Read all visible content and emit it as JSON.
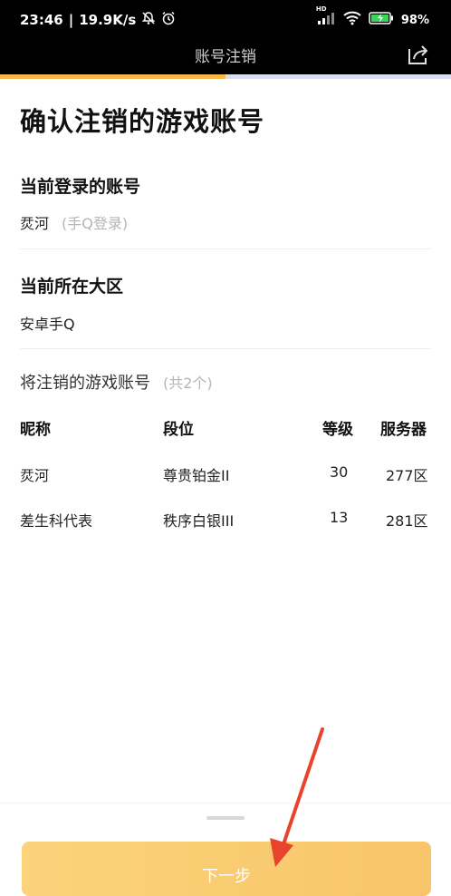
{
  "status_bar": {
    "time": "23:46",
    "speed": "19.9K/s",
    "battery": "98%",
    "hd_label": "HD"
  },
  "header": {
    "title": "账号注销",
    "progress_fraction": 0.5
  },
  "page": {
    "heading": "确认注销的游戏账号",
    "current_account_label": "当前登录的账号",
    "current_account_value": "烎河",
    "current_account_hint": "(手Q登录)",
    "region_label": "当前所在大区",
    "region_value": "安卓手Q",
    "to_cancel_label": "将注销的游戏账号",
    "to_cancel_hint": "(共2个)"
  },
  "table": {
    "headers": [
      "昵称",
      "段位",
      "等级",
      "服务器"
    ],
    "rows": [
      [
        "烎河",
        "尊贵铂金II",
        "30",
        "277区"
      ],
      [
        "差生科代表",
        "秩序白银III",
        "13",
        "281区"
      ]
    ]
  },
  "footer": {
    "next_label": "下一步"
  },
  "colors": {
    "accent": "#f6b94a",
    "button": "#fbd37a",
    "annotation_arrow": "#e8442c"
  }
}
